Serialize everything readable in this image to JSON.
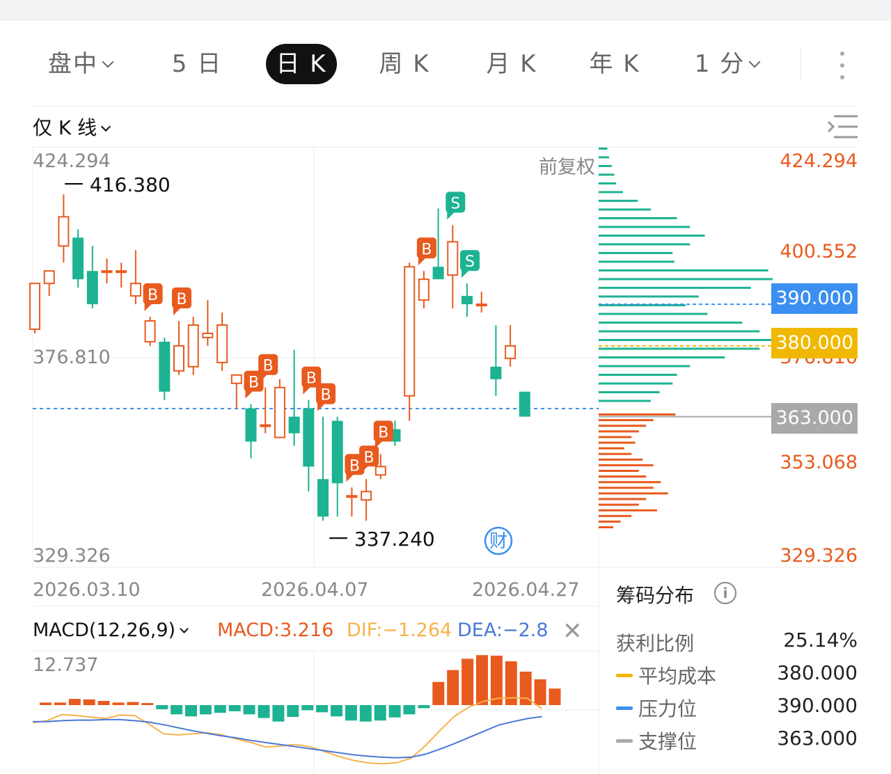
{
  "tabs": [
    {
      "label": "盘中",
      "dropdown": true
    },
    {
      "label": "5 日"
    },
    {
      "label": "日 K",
      "active": true
    },
    {
      "label": "周 K"
    },
    {
      "label": "月 K"
    },
    {
      "label": "年 K"
    },
    {
      "label": "1 分",
      "dropdown": true
    }
  ],
  "chart_header": {
    "mode_label": "仅 K 线",
    "adjust_label": "前复权"
  },
  "price_axis": {
    "left_labels": [
      "424.294",
      "376.810",
      "329.326"
    ],
    "right_labels": [
      "424.294",
      "400.552",
      "376.810",
      "353.068",
      "329.326"
    ],
    "high_marker": "416.380",
    "low_marker": "337.240",
    "tags": {
      "pressure": "390.000",
      "avg_cost": "380.000",
      "support": "363.000"
    }
  },
  "dates": [
    "2026.03.10",
    "2026.04.07",
    "2026.04.27"
  ],
  "macd": {
    "title": "MACD(12,26,9)",
    "macd_label": "MACD:3.216",
    "dif_label": "DIF:−1.264",
    "dea_label": "DEA:−2.8",
    "scale_top": "12.737"
  },
  "chip_panel": {
    "title": "筹码分布",
    "rows": [
      {
        "label": "获利比例",
        "value": "25.14%"
      },
      {
        "label": "平均成本",
        "value": "380.000"
      },
      {
        "label": "压力位",
        "value": "390.000"
      },
      {
        "label": "支撑位",
        "value": "363.000"
      }
    ]
  },
  "colors": {
    "up": "#e85a1e",
    "down": "#1db392",
    "pressure": "#3b8ff0",
    "avg_cost": "#f0b800",
    "support": "#a9a9a9",
    "dif": "#f6b24a",
    "dea": "#4a78d8"
  },
  "chart_data": {
    "type": "candlestick",
    "ylim": [
      329.326,
      424.294
    ],
    "candles": [
      [
        384,
        395,
        383,
        395
      ],
      [
        395,
        398,
        392,
        397
      ],
      [
        404,
        411,
        400,
        416.4
      ],
      [
        406,
        396,
        394,
        408
      ],
      [
        398,
        390,
        389,
        404
      ],
      [
        398,
        398,
        395,
        401
      ],
      [
        398,
        398,
        394,
        400
      ],
      [
        392,
        395,
        390,
        403
      ],
      [
        381,
        386,
        380,
        387
      ],
      [
        381,
        369,
        367,
        382
      ],
      [
        374,
        380,
        373,
        386
      ],
      [
        375,
        385,
        373,
        387
      ],
      [
        382,
        383,
        380,
        391
      ],
      [
        376,
        385,
        374,
        388
      ],
      [
        371,
        373,
        365,
        373
      ],
      [
        365,
        357,
        353,
        366
      ],
      [
        361,
        361,
        359,
        370
      ],
      [
        358,
        370,
        358,
        372
      ],
      [
        363,
        359,
        356,
        379
      ],
      [
        365,
        351,
        345,
        367
      ],
      [
        348,
        339,
        338,
        363
      ],
      [
        362,
        347,
        339,
        363
      ],
      [
        344,
        344,
        339,
        346
      ],
      [
        343,
        345,
        338,
        348
      ],
      [
        349,
        351,
        348,
        354
      ],
      [
        360,
        357,
        356,
        362
      ],
      [
        368,
        399,
        362,
        400
      ],
      [
        391,
        396,
        389,
        398
      ],
      [
        399,
        396,
        397,
        413
      ],
      [
        397,
        405,
        389,
        409
      ],
      [
        392,
        390,
        387,
        395
      ],
      [
        390,
        390,
        388,
        393
      ],
      [
        375,
        372,
        368,
        385
      ],
      [
        377,
        380,
        375,
        385
      ],
      [
        369,
        363,
        363,
        369
      ]
    ],
    "buy_markers": [
      8,
      10,
      15,
      16,
      19,
      20,
      22,
      23,
      24,
      27
    ],
    "sell_markers": [
      29,
      30
    ],
    "macd": {
      "hist": [
        0.5,
        0.5,
        1.2,
        1.1,
        0.8,
        0.5,
        0.6,
        0.4,
        -0.8,
        -1.8,
        -2.2,
        -1.8,
        -1.5,
        -1.2,
        -1.8,
        -2.5,
        -3.2,
        -2.3,
        -1.0,
        -1.4,
        -2.2,
        -3.0,
        -3.2,
        -3.0,
        -2.4,
        -1.8,
        -0.6,
        4.5,
        6.8,
        9.0,
        9.7,
        9.6,
        8.5,
        6.5,
        5.0,
        3.216
      ],
      "dif": [
        -4.0,
        -3.6,
        -2.4,
        -2.6,
        -2.9,
        -3.2,
        -2.5,
        -2.6,
        -4.3,
        -6.2,
        -6.4,
        -6.2,
        -6.0,
        -6.4,
        -7.2,
        -7.9,
        -8.8,
        -8.6,
        -8.3,
        -8.7,
        -9.6,
        -10.6,
        -11.4,
        -11.9,
        -12.1,
        -11.9,
        -11.0,
        -8.5,
        -5.5,
        -2.7,
        -0.9,
        0.2,
        0.8,
        0.9,
        0.8,
        -1.264
      ],
      "dea": [
        -3.8,
        -3.8,
        -3.6,
        -3.5,
        -3.5,
        -3.4,
        -3.4,
        -3.6,
        -3.9,
        -4.4,
        -5.0,
        -5.6,
        -6.1,
        -6.6,
        -7.0,
        -7.5,
        -7.9,
        -8.3,
        -8.7,
        -9.1,
        -9.5,
        -9.9,
        -10.3,
        -10.6,
        -10.8,
        -10.9,
        -10.8,
        -10.2,
        -9.2,
        -8.1,
        -6.9,
        -5.7,
        -4.5,
        -3.8,
        -3.2,
        -2.8
      ]
    },
    "chip": {
      "green": [
        1.0,
        1.2,
        1.5,
        1.8,
        2.0,
        2.8,
        4.5,
        6.0,
        9.0,
        10.5,
        12.2,
        10.5,
        8.5,
        8.7,
        19.5,
        20.0,
        17.5,
        11.5,
        10.0,
        12.5,
        16.5,
        18.5,
        20.5,
        18.5,
        14.5,
        10.5,
        9.0,
        8.5,
        7.0,
        6.0
      ],
      "red": [
        10.5,
        7.5,
        6.5,
        5.5,
        4.5,
        5.0,
        3.5,
        4.5,
        6.0,
        7.5,
        5.5,
        6.5,
        8.5,
        7.5,
        9.5,
        6.5,
        5.5,
        8.0,
        4.5,
        3.0,
        2.0
      ]
    }
  }
}
